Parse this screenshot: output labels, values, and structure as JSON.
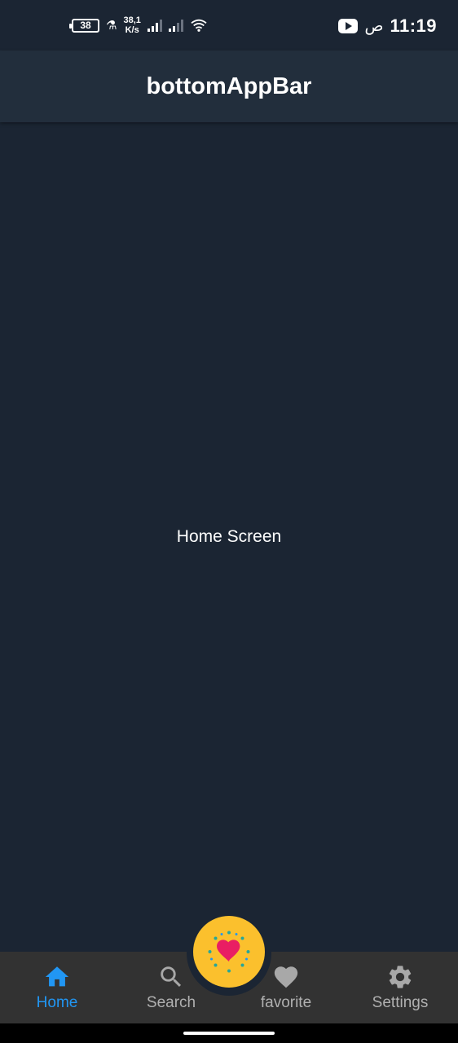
{
  "status_bar": {
    "battery_level": "38",
    "net_speed_value": "38,1",
    "net_speed_unit": "K/s",
    "ampm": "ص",
    "time": "11:19"
  },
  "app_bar": {
    "title": "bottomAppBar"
  },
  "screen": {
    "body_text": "Home Screen"
  },
  "bottom_nav": {
    "active_color": "#2196f3",
    "inactive_color": "#b0b0b0",
    "items": [
      {
        "label": "Home",
        "icon": "home-icon",
        "active": true
      },
      {
        "label": "Search",
        "icon": "search-icon",
        "active": false
      },
      {
        "label": "favorite",
        "icon": "heart-icon",
        "active": false
      },
      {
        "label": "Settings",
        "icon": "settings-gear-icon",
        "active": false
      }
    ]
  },
  "fab": {
    "icon": "heart-sparkle-icon",
    "color": "#fbc02d"
  },
  "colors": {
    "background": "#1b2533",
    "app_bar": "#222e3c",
    "bottom_bar": "#323232"
  }
}
